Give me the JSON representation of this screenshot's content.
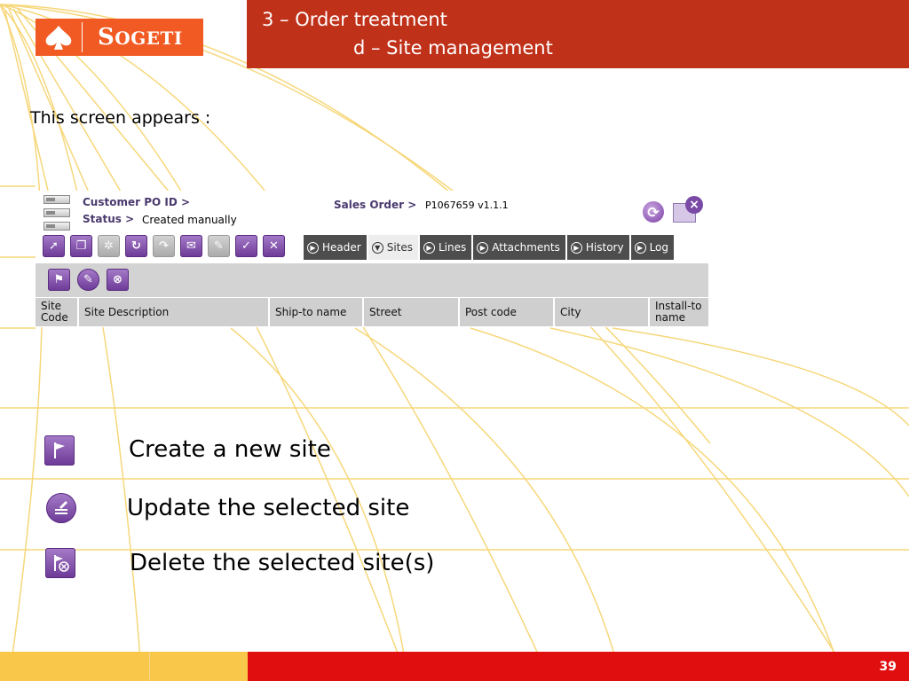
{
  "logo": {
    "text_initial": "S",
    "text_rest": "OGETI"
  },
  "title": {
    "line1": "3 – Order treatment",
    "line2": "d – Site management"
  },
  "intro": "This screen appears :",
  "app": {
    "customer_po_label": "Customer PO ID >",
    "status_label": "Status >",
    "status_value": "Created manually",
    "sales_order_label": "Sales Order >",
    "sales_order_value": "P1067659  v1.1.1",
    "toolbar_icons": [
      "next-icon",
      "copy-icon",
      "settings-icon",
      "refresh-check-icon",
      "forward-icon",
      "mail-icon",
      "sign-icon",
      "validate-icon",
      "cancel-icon"
    ],
    "tabs": [
      {
        "label": "Header",
        "active": false
      },
      {
        "label": "Sites",
        "active": true
      },
      {
        "label": "Lines",
        "active": false
      },
      {
        "label": "Attachments",
        "active": false
      },
      {
        "label": "History",
        "active": false
      },
      {
        "label": "Log",
        "active": false
      }
    ],
    "columns": [
      "Site Code",
      "Site Description",
      "Ship-to name",
      "Street",
      "Post code",
      "City",
      "Install-to name"
    ]
  },
  "legend": [
    {
      "icon": "flag-icon",
      "text": "Create a new site"
    },
    {
      "icon": "edit-site-icon",
      "text": "Update the selected site"
    },
    {
      "icon": "delete-site-icon",
      "text": "Delete the selected site(s)"
    }
  ],
  "page_number": "39",
  "colors": {
    "title_bar": "#c0311a",
    "logo": "#f15a22",
    "footer_red": "#e00e0e",
    "footer_yellow": "#f9c84a",
    "accent_purple": "#6c3996",
    "tab_dark": "#4d4d4d"
  }
}
